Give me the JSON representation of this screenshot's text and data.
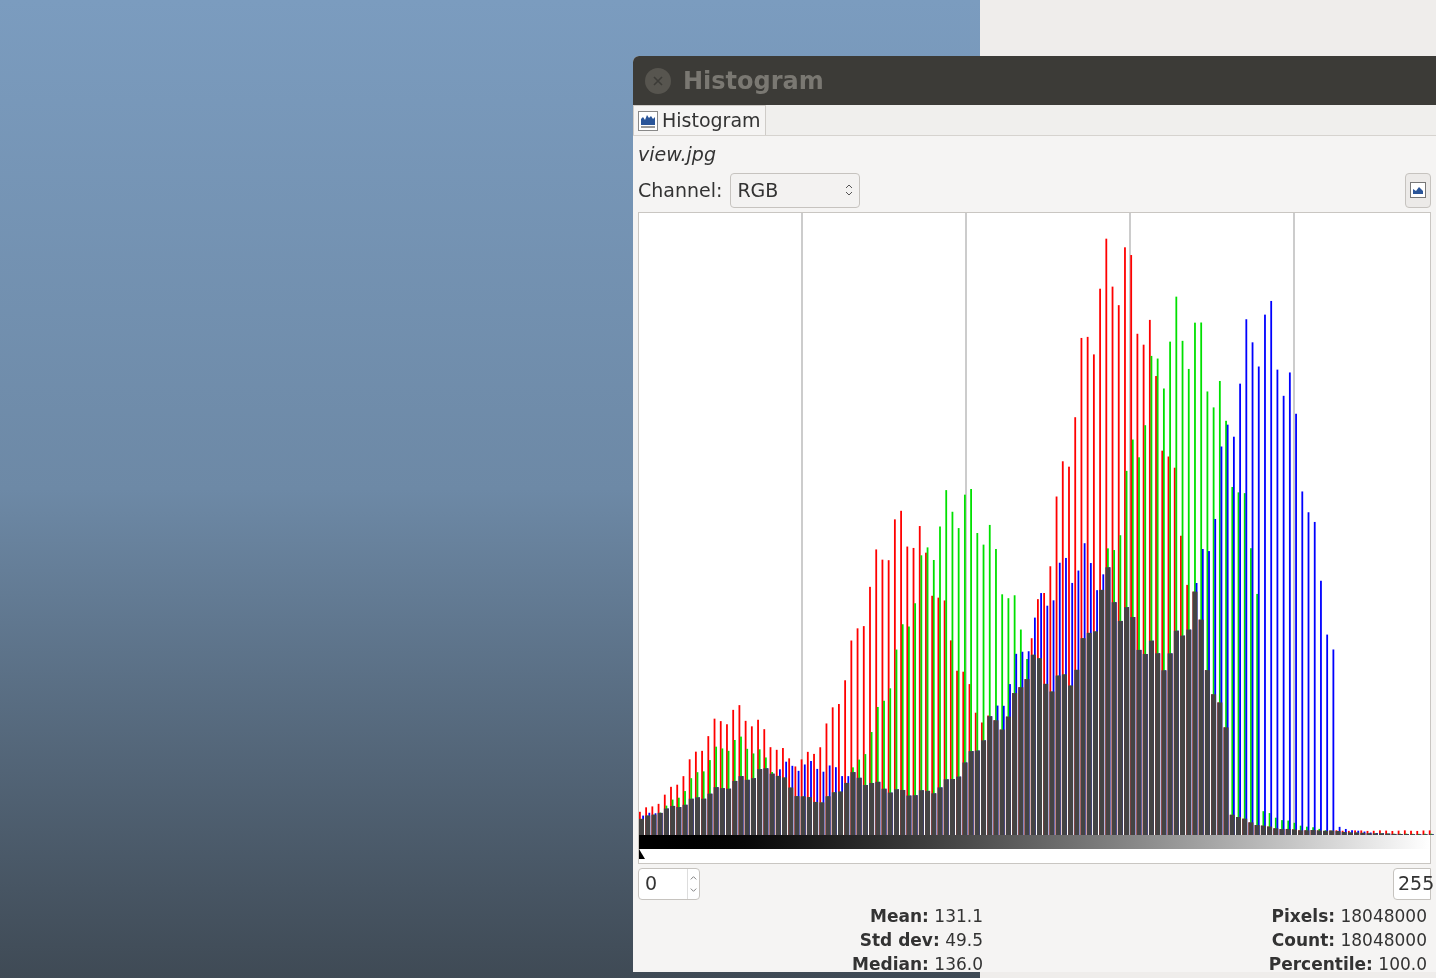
{
  "window": {
    "title": "Histogram"
  },
  "tab": {
    "label": "Histogram",
    "selected": true
  },
  "image_name": "view.jpg",
  "channel": {
    "label": "Channel:",
    "value": "RGB"
  },
  "range": {
    "low": "0",
    "high": "255"
  },
  "stats_left": [
    {
      "label": "Mean:",
      "value": "131.1"
    },
    {
      "label": "Std dev:",
      "value": "49.5"
    },
    {
      "label": "Median:",
      "value": "136.0"
    }
  ],
  "stats_right": [
    {
      "label": "Pixels:",
      "value": "18048000"
    },
    {
      "label": "Count:",
      "value": "18048000"
    },
    {
      "label": "Percentile:",
      "value": "100.0"
    }
  ]
}
